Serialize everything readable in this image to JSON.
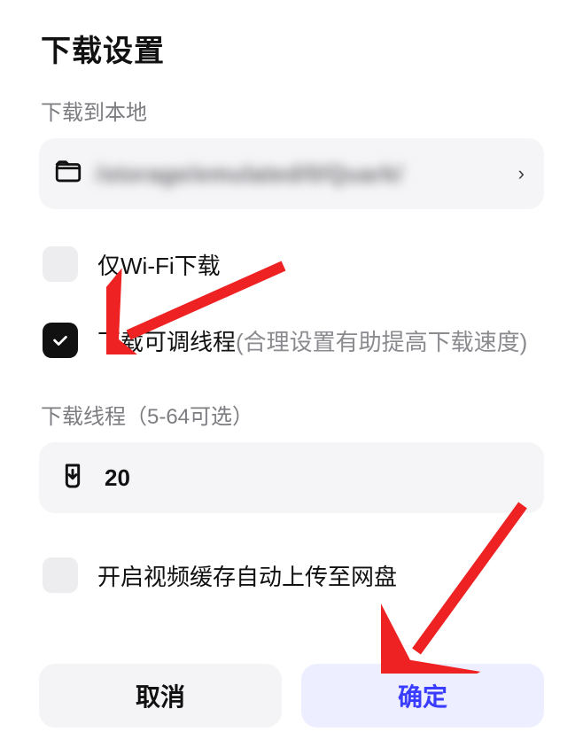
{
  "title": "下载设置",
  "section_path_label": "下载到本地",
  "path_value": "/storage/emulated/0/Quark/",
  "options": {
    "wifi_only": {
      "label": "仅Wi-Fi下载",
      "checked": false
    },
    "adjustable_threads": {
      "label": "下载可调线程",
      "hint": "(合理设置有助提高下载速度)",
      "checked": true
    },
    "auto_upload_cloud": {
      "label": "开启视频缓存自动上传至网盘",
      "checked": false
    }
  },
  "threads": {
    "section_label": "下载线程（5-64可选）",
    "value": "20"
  },
  "buttons": {
    "cancel": "取消",
    "ok": "确定"
  }
}
